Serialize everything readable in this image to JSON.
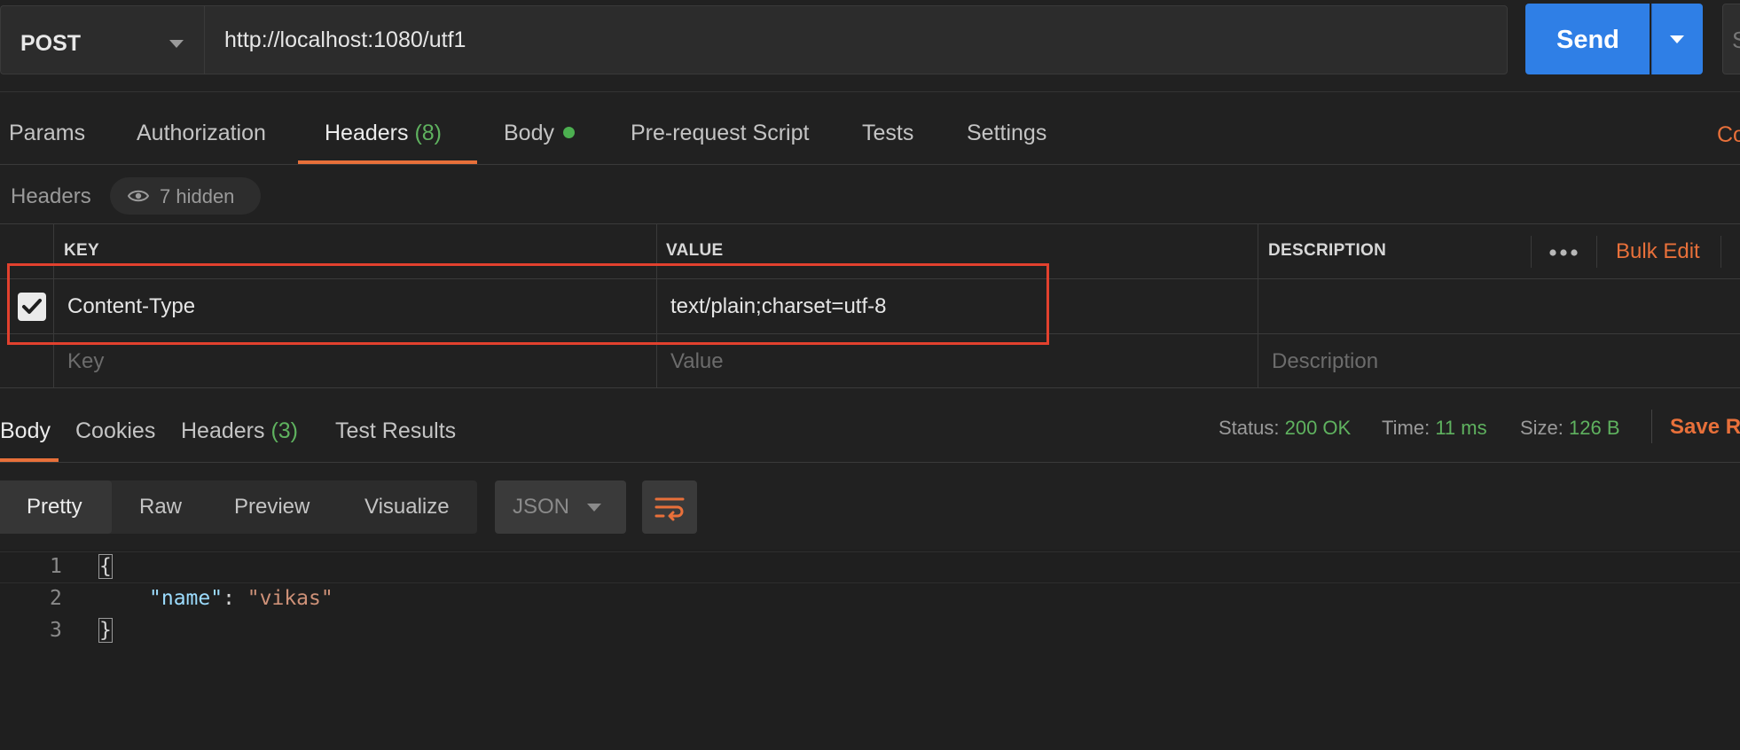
{
  "request": {
    "method": "POST",
    "url": "http://localhost:1080/utf1",
    "send_label": "Send",
    "save_edge_letter": "S"
  },
  "request_tabs": {
    "params": "Params",
    "authorization": "Authorization",
    "headers": "Headers",
    "headers_count": "(8)",
    "body": "Body",
    "pre_request_script": "Pre-request Script",
    "tests": "Tests",
    "settings": "Settings",
    "cookies_edge": "Co"
  },
  "headers_section": {
    "title": "Headers",
    "hidden_label": "7 hidden"
  },
  "headers_table": {
    "columns": {
      "key": "KEY",
      "value": "VALUE",
      "description": "DESCRIPTION"
    },
    "bulk_edit": "Bulk Edit",
    "rows": [
      {
        "key": "Content-Type",
        "value": "text/plain;charset=utf-8",
        "description": "",
        "checked": true
      }
    ],
    "placeholders": {
      "key": "Key",
      "value": "Value",
      "description": "Description"
    }
  },
  "response_tabs": {
    "body": "Body",
    "cookies": "Cookies",
    "headers": "Headers",
    "headers_count": "(3)",
    "test_results": "Test Results"
  },
  "response_status": {
    "status_label": "Status:",
    "status_value": "200 OK",
    "time_label": "Time:",
    "time_value": "11 ms",
    "size_label": "Size:",
    "size_value": "126 B",
    "save_response": "Save Re"
  },
  "view_options": {
    "pretty": "Pretty",
    "raw": "Raw",
    "preview": "Preview",
    "visualize": "Visualize",
    "format": "JSON"
  },
  "editor": {
    "line_numbers": [
      "1",
      "2",
      "3"
    ],
    "open_brace": "{",
    "json_key": "\"name\"",
    "colon": ": ",
    "json_value": "\"vikas\"",
    "close_brace": "}"
  },
  "colors": {
    "accent_orange": "#e8703a",
    "send_blue": "#2f7fe6",
    "success_green": "#5fb25f",
    "highlight_red": "#e2412e"
  }
}
